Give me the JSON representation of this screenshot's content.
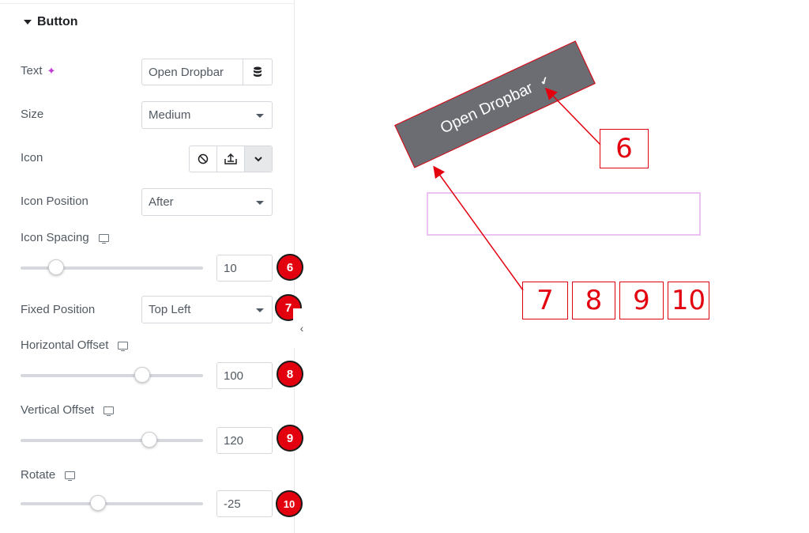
{
  "panel": {
    "section_title": "Button",
    "text_label": "Text",
    "text_value": "Open Dropbar",
    "size_label": "Size",
    "size_value": "Medium",
    "icon_label": "Icon",
    "icon_position_label": "Icon Position",
    "icon_position_value": "After",
    "icon_spacing_label": "Icon Spacing",
    "icon_spacing_value": "10",
    "icon_spacing_level": 0.2,
    "fixed_position_label": "Fixed Position",
    "fixed_position_value": "Top Left",
    "horizontal_offset_label": "Horizontal Offset",
    "horizontal_offset_value": "100",
    "horizontal_offset_level": 0.67,
    "vertical_offset_label": "Vertical Offset",
    "vertical_offset_value": "120",
    "vertical_offset_level": 0.71,
    "rotate_label": "Rotate",
    "rotate_value": "-25",
    "rotate_level": 0.43
  },
  "badges": [
    "6",
    "7",
    "8",
    "9",
    "10"
  ],
  "preview": {
    "button_text": "Open Dropbar",
    "callouts": [
      "6",
      "7",
      "8",
      "9",
      "10"
    ]
  },
  "icons": {
    "ai": "sparkle-icon",
    "dynamic": "database-icon",
    "none": "ban-icon",
    "upload": "upload-icon",
    "dropdown": "chevron-down-icon",
    "responsive": "desktop-icon",
    "collapse": "chevron-left-icon"
  },
  "colors": {
    "annotation": "#e3000f",
    "button_bg": "#6b6d73",
    "dropbar_outline": "#ecc2f2"
  }
}
